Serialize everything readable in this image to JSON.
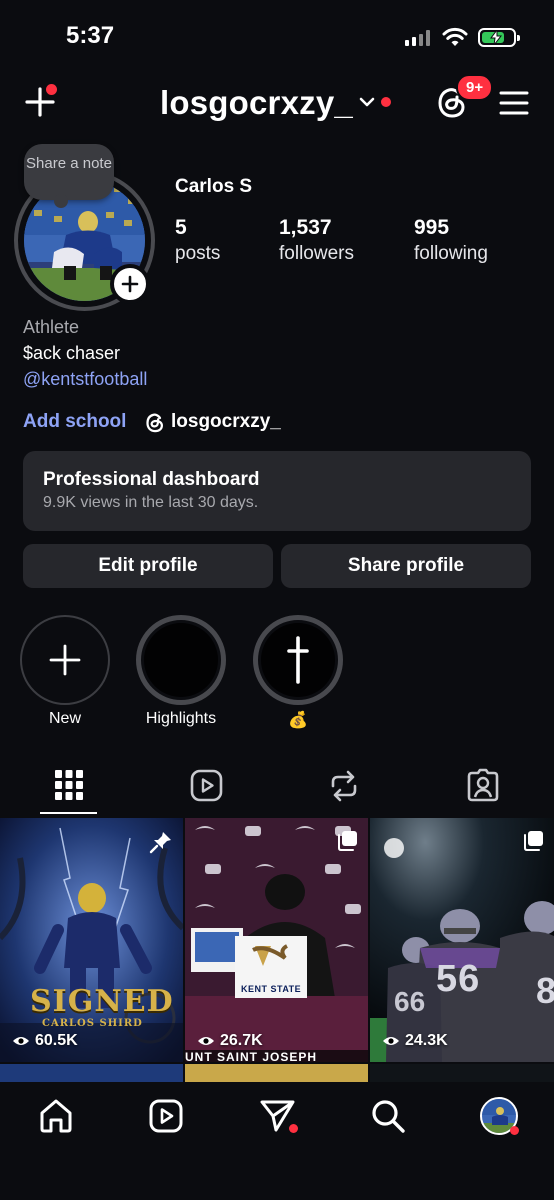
{
  "status_bar": {
    "time": "5:37"
  },
  "header": {
    "username": "losgocrxzy_",
    "notification_badge": "9+"
  },
  "profile": {
    "note_text": "Share a note",
    "display_name": "Carlos S",
    "stats": [
      {
        "count": "5",
        "label": "posts"
      },
      {
        "count": "1,537",
        "label": "followers"
      },
      {
        "count": "995",
        "label": "following"
      }
    ],
    "bio_category": "Athlete",
    "bio_text": "$ack chaser",
    "bio_link": "@kentstfootball",
    "add_school": "Add school",
    "threads_handle": "losgocrxzy_"
  },
  "dashboard": {
    "title": "Professional dashboard",
    "subtitle": "9.9K views in the last 30 days."
  },
  "buttons": {
    "edit_profile": "Edit profile",
    "share_profile": "Share profile"
  },
  "highlights": [
    {
      "label": "New"
    },
    {
      "label": "Highlights"
    },
    {
      "label": "💰"
    }
  ],
  "tabs": [
    "grid-icon",
    "reels-icon",
    "reposts-icon",
    "tagged-icon"
  ],
  "posts": [
    {
      "views": "60.5K",
      "title_art": "SIGNED",
      "subtitle_art": "CARLOS SHIRD",
      "pinned": true
    },
    {
      "views": "26.7K",
      "sign_text": "KENT STATE",
      "banner_text": "UNT SAINT JOSEPH"
    },
    {
      "views": "24.3K",
      "jersey_1": "56",
      "jersey_2": "66",
      "jersey_3": "8"
    }
  ],
  "colors": {
    "background": "#0b0c10",
    "surface": "#26272c",
    "accent_link": "#8ea3f5",
    "notification_red": "#ff3040"
  }
}
